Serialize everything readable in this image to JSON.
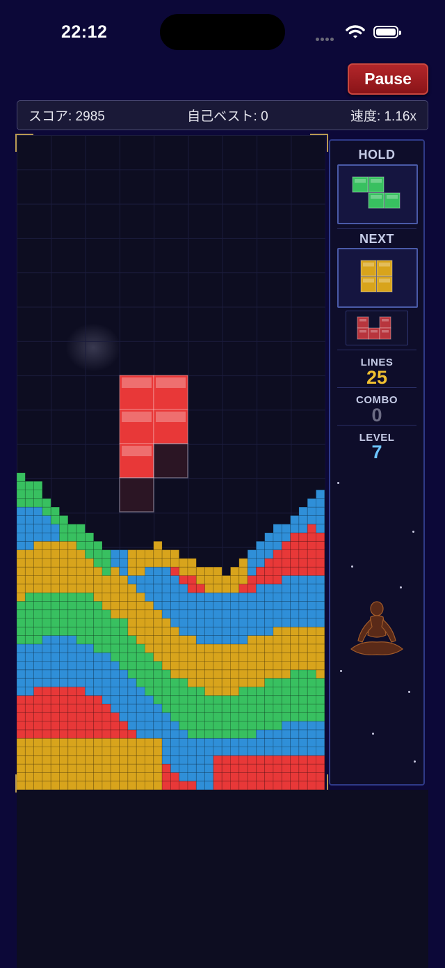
{
  "status_bar": {
    "time": "22:12"
  },
  "header": {
    "pause_label": "Pause",
    "score_text": "スコア: 2985",
    "best_text": "自己ベスト: 0",
    "speed_text": "速度: 1.16x"
  },
  "side_panel": {
    "hold_label": "HOLD",
    "next_label": "NEXT",
    "lines_label": "LINES",
    "lines_value": "25",
    "combo_label": "COMBO",
    "combo_value": "0",
    "level_label": "LEVEL",
    "level_value": "7",
    "hold_piece": "Z",
    "next_pieces": [
      "O",
      "T"
    ]
  },
  "colors": {
    "red": "#e83838",
    "green": "#38c060",
    "yellow": "#d8a41c",
    "blue": "#2f8fd8",
    "lines_value": "#f0c030",
    "combo_value": "#6c6c84",
    "level_value": "#6cc4ff"
  },
  "active_piece": {
    "type": "J",
    "color": "red"
  }
}
